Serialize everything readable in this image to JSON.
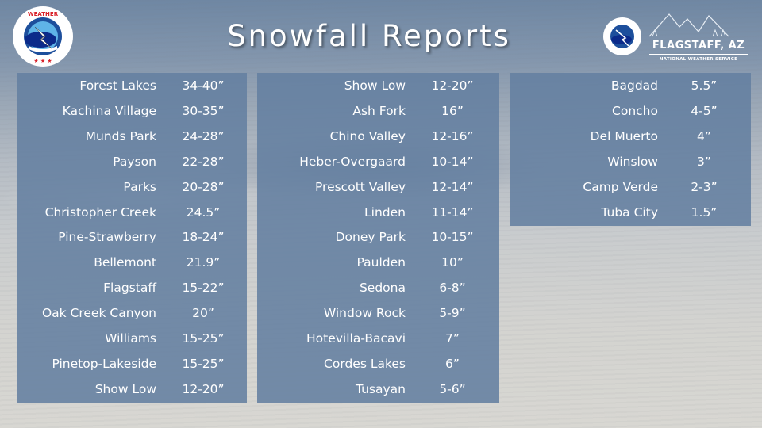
{
  "title": "Snowfall Reports",
  "logos": {
    "left_logo": "National Weather Service emblem",
    "brand_name": "FLAGSTAFF, AZ",
    "brand_subtitle": "NATIONAL WEATHER SERVICE",
    "emblem_text": "NATIONAL WEATHER SERVICE"
  },
  "columns": [
    {
      "rows": [
        {
          "location": "Forest Lakes",
          "amount": "34-40”"
        },
        {
          "location": "Kachina Village",
          "amount": "30-35”"
        },
        {
          "location": "Munds Park",
          "amount": "24-28”"
        },
        {
          "location": "Payson",
          "amount": "22-28”"
        },
        {
          "location": "Parks",
          "amount": "20-28”"
        },
        {
          "location": "Christopher Creek",
          "amount": "24.5”"
        },
        {
          "location": "Pine-Strawberry",
          "amount": "18-24”"
        },
        {
          "location": "Bellemont",
          "amount": "21.9”"
        },
        {
          "location": "Flagstaff",
          "amount": "15-22”"
        },
        {
          "location": "Oak Creek Canyon",
          "amount": "20”"
        },
        {
          "location": "Williams",
          "amount": "15-25”"
        },
        {
          "location": "Pinetop-Lakeside",
          "amount": "15-25”"
        },
        {
          "location": "Show Low",
          "amount": "12-20”"
        }
      ]
    },
    {
      "rows": [
        {
          "location": "Show Low",
          "amount": "12-20”"
        },
        {
          "location": "Ash Fork",
          "amount": "16”"
        },
        {
          "location": "Chino Valley",
          "amount": "12-16”"
        },
        {
          "location": "Heber-Overgaard",
          "amount": "10-14”"
        },
        {
          "location": "Prescott Valley",
          "amount": "12-14”"
        },
        {
          "location": "Linden",
          "amount": "11-14”"
        },
        {
          "location": "Doney Park",
          "amount": "10-15”"
        },
        {
          "location": "Paulden",
          "amount": "10”"
        },
        {
          "location": "Sedona",
          "amount": "6-8”"
        },
        {
          "location": "Window Rock",
          "amount": "5-9”"
        },
        {
          "location": "Hotevilla-Bacavi",
          "amount": "7”"
        },
        {
          "location": "Cordes Lakes",
          "amount": "6”"
        },
        {
          "location": "Tusayan",
          "amount": "5-6”"
        }
      ]
    },
    {
      "rows": [
        {
          "location": "Bagdad",
          "amount": "5.5”"
        },
        {
          "location": "Concho",
          "amount": "4-5”"
        },
        {
          "location": "Del Muerto",
          "amount": "4”"
        },
        {
          "location": "Winslow",
          "amount": "3”"
        },
        {
          "location": "Camp Verde",
          "amount": "2-3”"
        },
        {
          "location": "Tuba City",
          "amount": "1.5”"
        }
      ]
    }
  ]
}
